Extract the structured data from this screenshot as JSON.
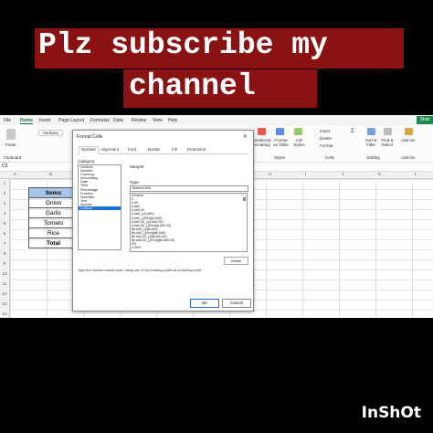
{
  "overlay": {
    "line1": "Plz subscribe my",
    "line2": "channel"
  },
  "watermark": "InShOt",
  "menu": {
    "tabs": [
      "File",
      "Home",
      "Insert",
      "Page Layout",
      "Formulas",
      "Data",
      "Review",
      "View",
      "Help"
    ],
    "active": "Home",
    "share": "Shar"
  },
  "ribbon": {
    "paste": "Paste",
    "clipboard": "Clipboard",
    "font_name": "Verdana",
    "conditional": "Conditional Formatting",
    "format_table": "Format as Table",
    "cell_styles": "Cell Styles",
    "styles": "Styles",
    "insert": "Insert",
    "delete": "Delete",
    "format": "Format",
    "cells": "Cells",
    "sort": "Sort & Filter",
    "find": "Find & Select",
    "editing": "Editing",
    "addins": "Add-ins",
    "addins_group": "Add-ins"
  },
  "formula_bar": {
    "namebox": "C3"
  },
  "columns": [
    "A",
    "B",
    "C",
    "D",
    "E",
    "F",
    "G",
    "H",
    "I",
    "J",
    "K",
    "L"
  ],
  "table": {
    "header": "Items",
    "rows": [
      "Onion",
      "Garlic",
      "Tomato",
      "Rice"
    ],
    "total": "Total"
  },
  "dialog": {
    "title": "Format Cells",
    "close": "✕",
    "tabs": [
      "Number",
      "Alignment",
      "Font",
      "Border",
      "Fill",
      "Protection"
    ],
    "category_label": "Category:",
    "categories": [
      "General",
      "Number",
      "Currency",
      "Accounting",
      "Date",
      "Time",
      "Percentage",
      "Fraction",
      "Scientific",
      "Text",
      "Special",
      "Custom"
    ],
    "selected_category": "Custom",
    "sample_label": "Sample",
    "type_label": "Type:",
    "type_value": "General ###",
    "types": [
      "General",
      "0",
      "0.00",
      "#,##0",
      "#,##0.00",
      "#,##0_);(#,##0)",
      "#,##0_);[Red](#,##0)",
      "#,##0.00_);(#,##0.00)",
      "#,##0.00_);[Red](#,##0.00)",
      "$#,##0_);($#,##0)",
      "$#,##0_);[Red]($#,##0)",
      "$#,##0.00_);($#,##0.00)",
      "$#,##0.00_);[Red]($#,##0.00)",
      "0%",
      "0.00%"
    ],
    "delete_btn": "Delete",
    "hint": "Type the number format code, using one of the existing codes as a starting point.",
    "ok": "OK",
    "cancel": "Cancel"
  }
}
